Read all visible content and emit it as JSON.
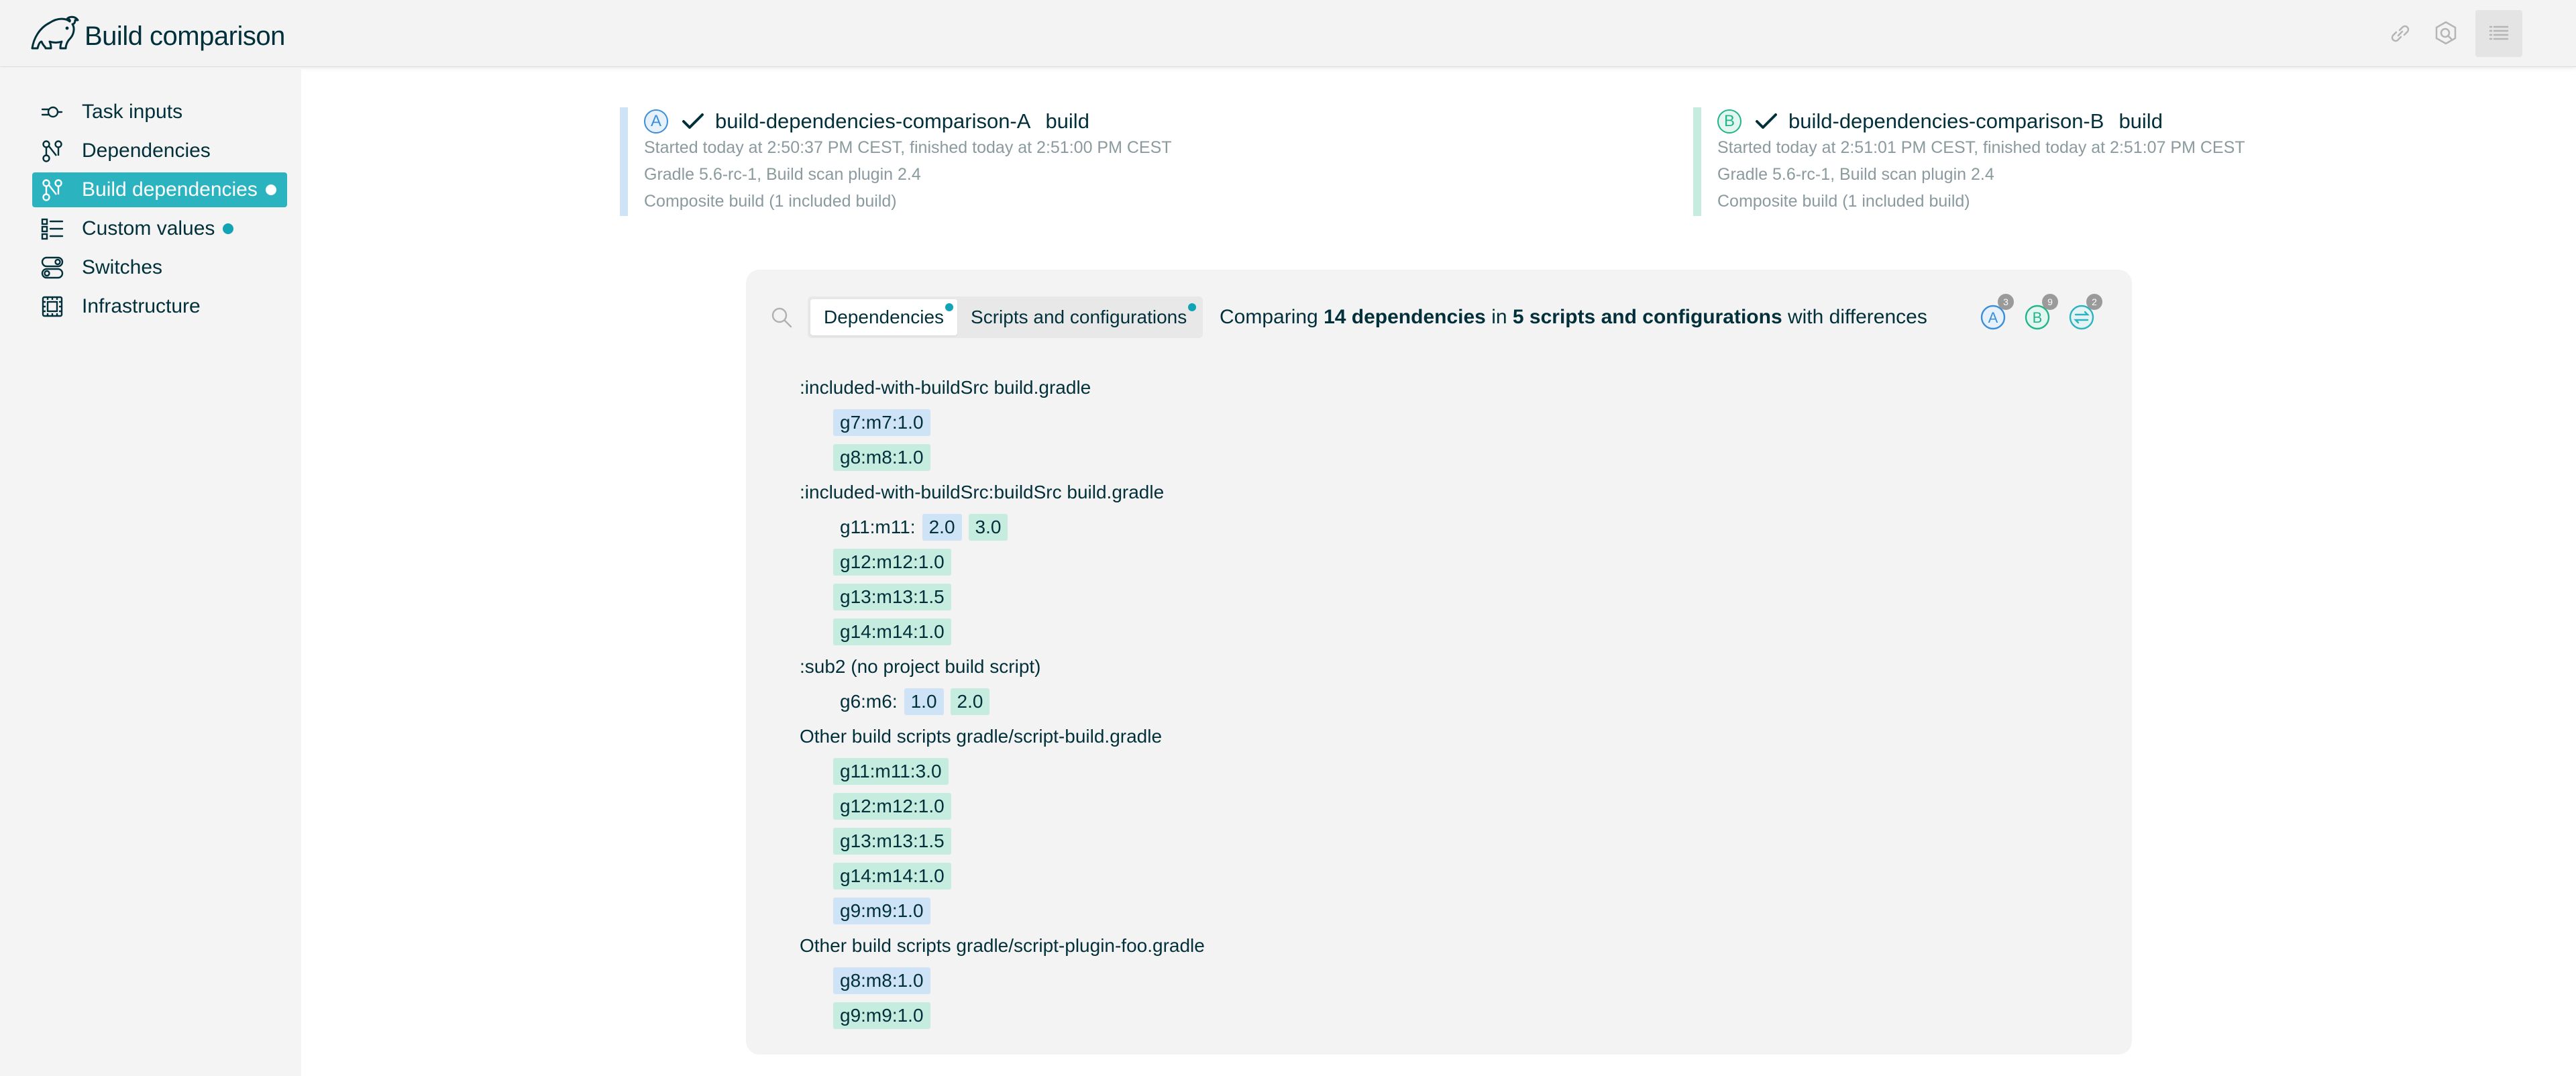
{
  "app": {
    "title": "Build comparison"
  },
  "colors": {
    "accent": "#2bb3c0",
    "build_a": "#cfe3f7",
    "build_b": "#c5ecdf",
    "text": "#02303a"
  },
  "header": {
    "icons": [
      "link-icon",
      "settings-gear-icon",
      "menu-list-icon"
    ]
  },
  "sidebar": {
    "items": [
      {
        "label": "Task inputs",
        "icon": "task-inputs-icon",
        "active": false,
        "dot": false
      },
      {
        "label": "Dependencies",
        "icon": "dependencies-icon",
        "active": false,
        "dot": false
      },
      {
        "label": "Build dependencies",
        "icon": "build-dependencies-icon",
        "active": true,
        "dot": true
      },
      {
        "label": "Custom values",
        "icon": "custom-values-icon",
        "active": false,
        "dot": true
      },
      {
        "label": "Switches",
        "icon": "switches-icon",
        "active": false,
        "dot": false
      },
      {
        "label": "Infrastructure",
        "icon": "infrastructure-icon",
        "active": false,
        "dot": false
      }
    ]
  },
  "builds": {
    "a": {
      "badge": "A",
      "name": "build-dependencies-comparison-A",
      "task": "build",
      "timing": "Started today at 2:50:37 PM CEST, finished today at 2:51:00 PM CEST",
      "versions": "Gradle 5.6-rc-1,  Build scan plugin 2.4",
      "composite": "Composite build (1 included build)"
    },
    "b": {
      "badge": "B",
      "name": "build-dependencies-comparison-B",
      "task": "build",
      "timing": "Started today at 2:51:01 PM CEST, finished today at 2:51:07 PM CEST",
      "versions": "Gradle 5.6-rc-1,  Build scan plugin 2.4",
      "composite": "Composite build (1 included build)"
    }
  },
  "panel": {
    "tabs": [
      {
        "label": "Dependencies",
        "active": true,
        "dot": true
      },
      {
        "label": "Scripts and configurations",
        "active": false,
        "dot": true
      }
    ],
    "summary": {
      "prefix": "Comparing ",
      "deps": "14 dependencies",
      "middle": " in ",
      "scripts": "5 scripts and configurations",
      "suffix": " with differences"
    },
    "legend": [
      {
        "badge": "A",
        "count": "3"
      },
      {
        "badge": "B",
        "count": "9"
      },
      {
        "badge": "diff",
        "count": "2"
      }
    ]
  },
  "groups": [
    {
      "title": ":included-with-buildSrc build.gradle",
      "deps": [
        {
          "chips": [
            {
              "text": "g7:m7:1.0",
              "side": "a"
            }
          ]
        },
        {
          "chips": [
            {
              "text": "g8:m8:1.0",
              "side": "b"
            }
          ]
        }
      ]
    },
    {
      "title": ":included-with-buildSrc:buildSrc build.gradle",
      "deps": [
        {
          "name": "g11:m11:",
          "chips": [
            {
              "text": "2.0",
              "side": "a"
            },
            {
              "text": "3.0",
              "side": "b"
            }
          ]
        },
        {
          "chips": [
            {
              "text": "g12:m12:1.0",
              "side": "b"
            }
          ]
        },
        {
          "chips": [
            {
              "text": "g13:m13:1.5",
              "side": "b"
            }
          ]
        },
        {
          "chips": [
            {
              "text": "g14:m14:1.0",
              "side": "b"
            }
          ]
        }
      ]
    },
    {
      "title": ":sub2 (no project build script)",
      "deps": [
        {
          "name": "g6:m6:",
          "chips": [
            {
              "text": "1.0",
              "side": "a"
            },
            {
              "text": "2.0",
              "side": "b"
            }
          ]
        }
      ]
    },
    {
      "title": "Other build scripts gradle/script-build.gradle",
      "deps": [
        {
          "chips": [
            {
              "text": "g11:m11:3.0",
              "side": "b"
            }
          ]
        },
        {
          "chips": [
            {
              "text": "g12:m12:1.0",
              "side": "b"
            }
          ]
        },
        {
          "chips": [
            {
              "text": "g13:m13:1.5",
              "side": "b"
            }
          ]
        },
        {
          "chips": [
            {
              "text": "g14:m14:1.0",
              "side": "b"
            }
          ]
        },
        {
          "chips": [
            {
              "text": "g9:m9:1.0",
              "side": "a"
            }
          ]
        }
      ]
    },
    {
      "title": "Other build scripts gradle/script-plugin-foo.gradle",
      "deps": [
        {
          "chips": [
            {
              "text": "g8:m8:1.0",
              "side": "a"
            }
          ]
        },
        {
          "chips": [
            {
              "text": "g9:m9:1.0",
              "side": "b"
            }
          ]
        }
      ]
    }
  ]
}
